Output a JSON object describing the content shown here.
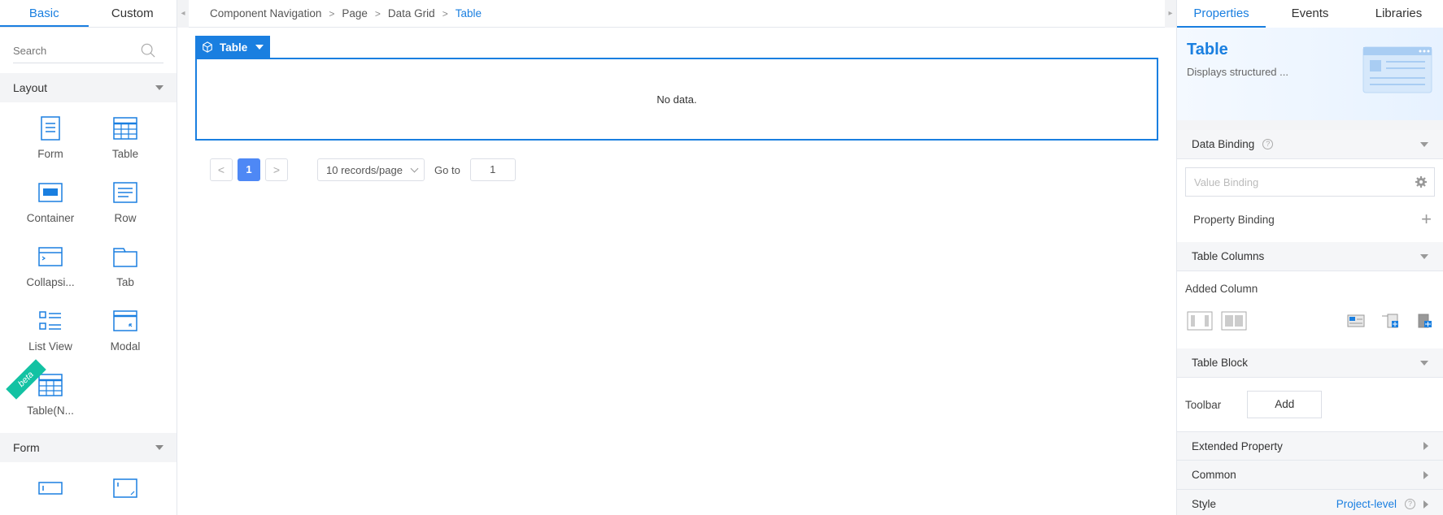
{
  "left_panel": {
    "tabs": [
      "Basic",
      "Custom"
    ],
    "search_placeholder": "Search",
    "groups": {
      "layout": {
        "title": "Layout",
        "items": [
          "Form",
          "Table",
          "Container",
          "Row",
          "Collapsi...",
          "Tab",
          "List View",
          "Modal",
          "Table(N..."
        ],
        "beta_badge": "beta"
      },
      "form": {
        "title": "Form"
      }
    }
  },
  "breadcrumb": {
    "items": [
      "Component Navigation",
      "Page",
      "Data Grid",
      "Table"
    ]
  },
  "canvas": {
    "selected_tag": "Table",
    "empty_text": "No data.",
    "pager": {
      "prev": "<",
      "current_page": "1",
      "next": ">",
      "page_size": "10 records/page",
      "goto_label": "Go to",
      "goto_value": "1"
    }
  },
  "right_panel": {
    "tabs": [
      "Properties",
      "Events",
      "Libraries"
    ],
    "hero": {
      "title": "Table",
      "description": "Displays structured ..."
    },
    "data_binding": {
      "title": "Data Binding",
      "value_placeholder": "Value Binding",
      "property_binding": "Property Binding"
    },
    "table_columns": {
      "title": "Table Columns",
      "added_label": "Added Column"
    },
    "table_block": {
      "title": "Table Block",
      "toolbar_label": "Toolbar",
      "add_button": "Add"
    },
    "extended": {
      "title": "Extended Property"
    },
    "common": {
      "title": "Common"
    },
    "style": {
      "title": "Style",
      "value": "Project-level"
    }
  },
  "colors": {
    "accent": "#1a7fe0",
    "beta": "#13c2a3",
    "page_active": "#4e88f5"
  }
}
